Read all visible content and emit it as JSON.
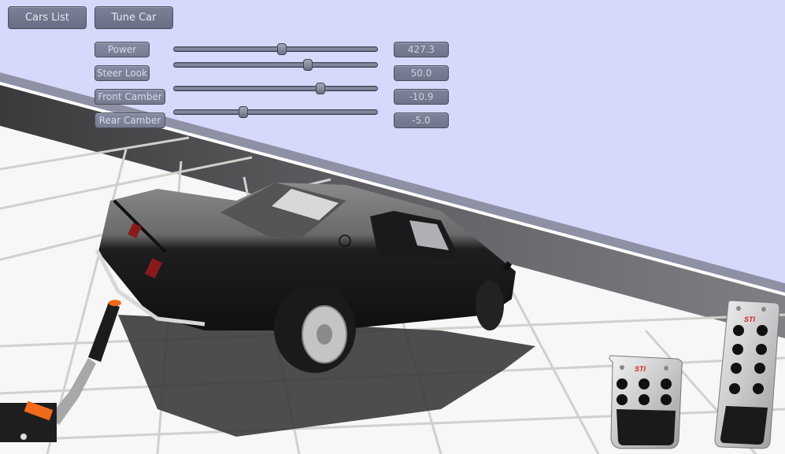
{
  "toolbar": {
    "cars_list_label": "Cars List",
    "tune_car_label": "Tune Car"
  },
  "tuning": {
    "sliders": [
      {
        "label": "Power",
        "value": "427.3",
        "position_fraction": 0.53
      },
      {
        "label": "Steer Look",
        "value": "50.0",
        "position_fraction": 0.66
      },
      {
        "label": "Front Camber",
        "value": "-10.9",
        "position_fraction": 0.72
      },
      {
        "label": "Rear Camber",
        "value": "-5.0",
        "position_fraction": 0.34
      }
    ]
  },
  "scene": {
    "sky_color": "#d6d9fb",
    "wall_color": "#7a7a7e",
    "floor_color": "#f6f6f6",
    "car_color": "#2a2a2c",
    "pedal_brand_text": "STI",
    "pedal_brand_color": "#d8232a",
    "handbrake_accent_color": "#f06a1a"
  }
}
